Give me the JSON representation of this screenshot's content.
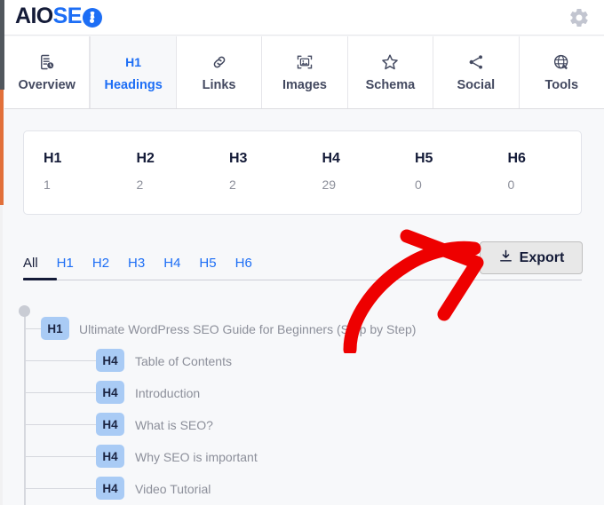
{
  "header": {
    "logo_aio": "AIO",
    "logo_se": "SE",
    "logo_o_icon": "aioseo-circle-icon",
    "settings_icon": "gear-icon"
  },
  "nav": {
    "tabs": [
      {
        "label": "Overview",
        "icon": "document-clock-icon",
        "active": false
      },
      {
        "label": "Headings",
        "icon": "H1",
        "active": true
      },
      {
        "label": "Links",
        "icon": "link-icon",
        "active": false
      },
      {
        "label": "Images",
        "icon": "image-frame-icon",
        "active": false
      },
      {
        "label": "Schema",
        "icon": "star-icon",
        "active": false
      },
      {
        "label": "Social",
        "icon": "share-icon",
        "active": false
      },
      {
        "label": "Tools",
        "icon": "globe-wrench-icon",
        "active": false
      }
    ]
  },
  "stats": [
    {
      "label": "H1",
      "value": "1"
    },
    {
      "label": "H2",
      "value": "2"
    },
    {
      "label": "H3",
      "value": "2"
    },
    {
      "label": "H4",
      "value": "29"
    },
    {
      "label": "H5",
      "value": "0"
    },
    {
      "label": "H6",
      "value": "0"
    }
  ],
  "filters": [
    {
      "label": "All",
      "active": true
    },
    {
      "label": "H1",
      "active": false
    },
    {
      "label": "H2",
      "active": false
    },
    {
      "label": "H3",
      "active": false
    },
    {
      "label": "H4",
      "active": false
    },
    {
      "label": "H5",
      "active": false
    },
    {
      "label": "H6",
      "active": false
    }
  ],
  "export": {
    "label": "Export",
    "icon": "download-icon"
  },
  "headings_tree": [
    {
      "level": "H1",
      "text": "Ultimate WordPress SEO Guide for Beginners (Step by Step)",
      "indent": 0
    },
    {
      "level": "H4",
      "text": "Table of Contents",
      "indent": 1
    },
    {
      "level": "H4",
      "text": "Introduction",
      "indent": 1
    },
    {
      "level": "H4",
      "text": "What is SEO?",
      "indent": 1
    },
    {
      "level": "H4",
      "text": "Why SEO is important",
      "indent": 1
    },
    {
      "level": "H4",
      "text": "Video Tutorial",
      "indent": 1
    }
  ],
  "annotation": {
    "type": "curved-arrow",
    "color": "#ee0000",
    "points_to": "Export"
  },
  "colors": {
    "brand_blue": "#1d6ef5",
    "navy": "#141b38",
    "badge_blue": "#a9cbf5",
    "muted_text": "#8c8f9a",
    "page_bg": "#f7f8fa",
    "annotation_red": "#ee0000"
  }
}
